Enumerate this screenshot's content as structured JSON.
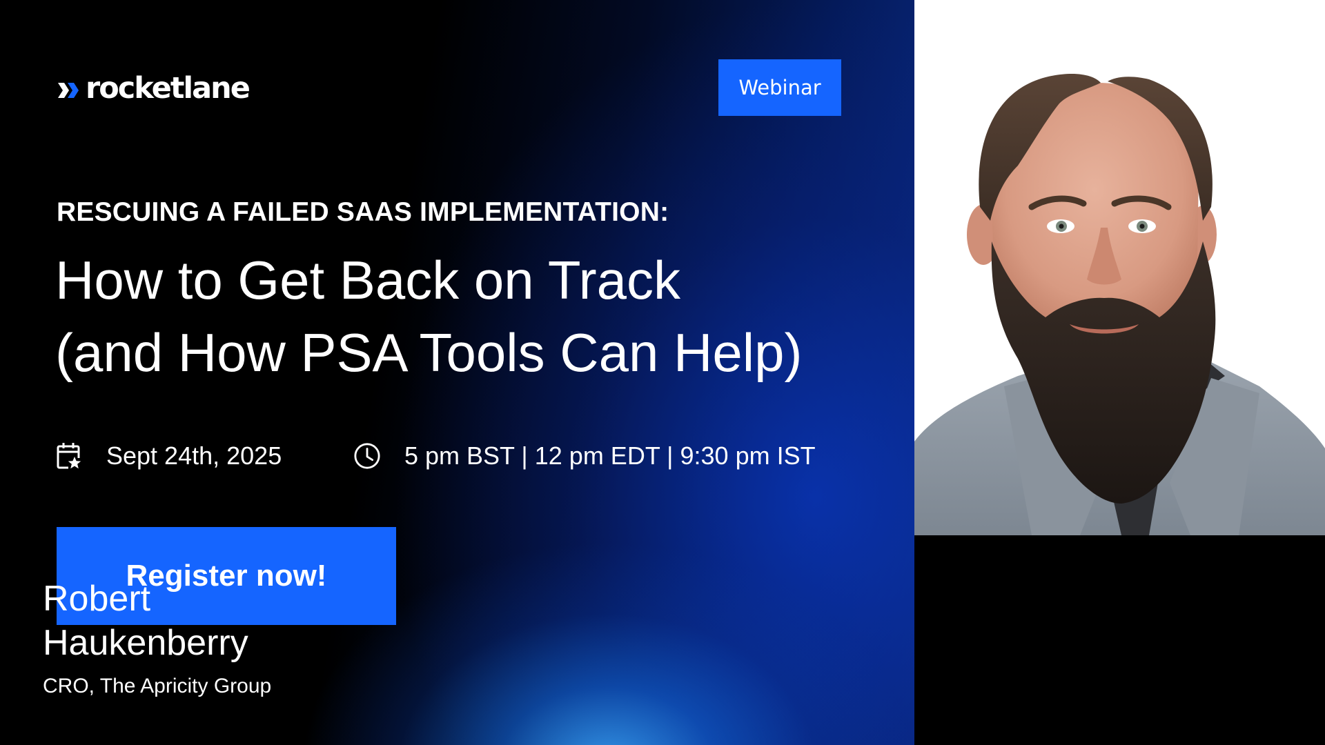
{
  "brand": {
    "name": "rocketlane",
    "accent_color": "#1565ff"
  },
  "badge": {
    "label": "Webinar"
  },
  "headline": {
    "kicker": "RESCUING A FAILED SAAS IMPLEMENTATION:",
    "title_line_1": "How to Get Back on Track",
    "title_line_2": "(and How PSA Tools Can Help)"
  },
  "event": {
    "date_icon": "calendar-star-icon",
    "date": "Sept 24th, 2025",
    "time_icon": "clock-icon",
    "time": "5 pm BST | 12 pm EDT | 9:30 pm IST"
  },
  "cta": {
    "label": "Register now!"
  },
  "speaker": {
    "first_name": "Robert",
    "last_name": "Haukenberry",
    "role": "CRO, The Apricity Group",
    "photo_icon": "speaker-portrait"
  }
}
